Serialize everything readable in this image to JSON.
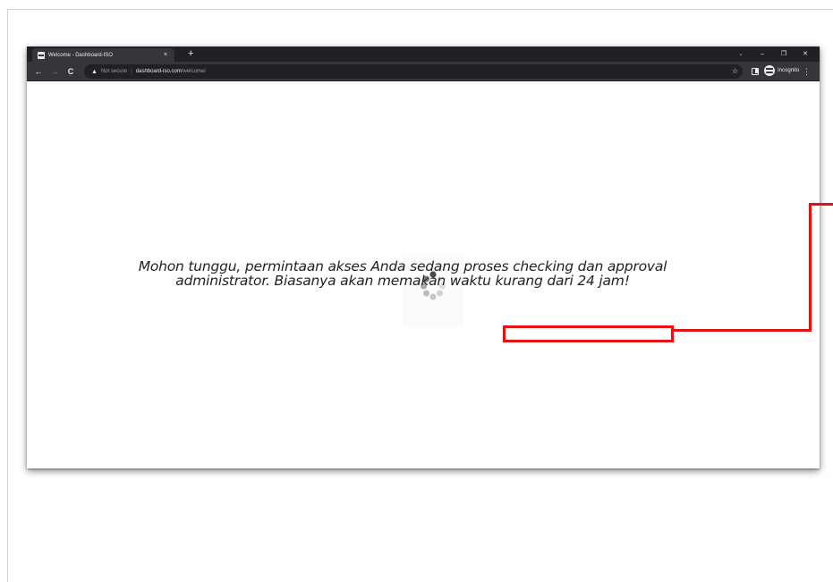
{
  "browser": {
    "tab": {
      "title": "Welcome - Dashboard-ISO",
      "close": "×"
    },
    "new_tab": "+",
    "window_controls": {
      "dropdown": "⌄",
      "minimize": "–",
      "maximize": "❐",
      "close": "✕"
    },
    "toolbar": {
      "back": "←",
      "forward": "→",
      "reload": "C",
      "security_label": "Not secure",
      "url_host": "dashboard-iso.com",
      "url_path": "/welcome/",
      "incognito_label": "Incognito",
      "menu": "⋮"
    }
  },
  "page": {
    "message_line1": "Mohon tunggu, permintaan akses Anda sedang proses checking dan approval",
    "message_line2": "administrator. Biasanya akan memakan waktu kurang dari 24 jam!"
  },
  "colors": {
    "annotation": "#e01414",
    "tabstrip": "#202124",
    "toolbar": "#35363a"
  }
}
